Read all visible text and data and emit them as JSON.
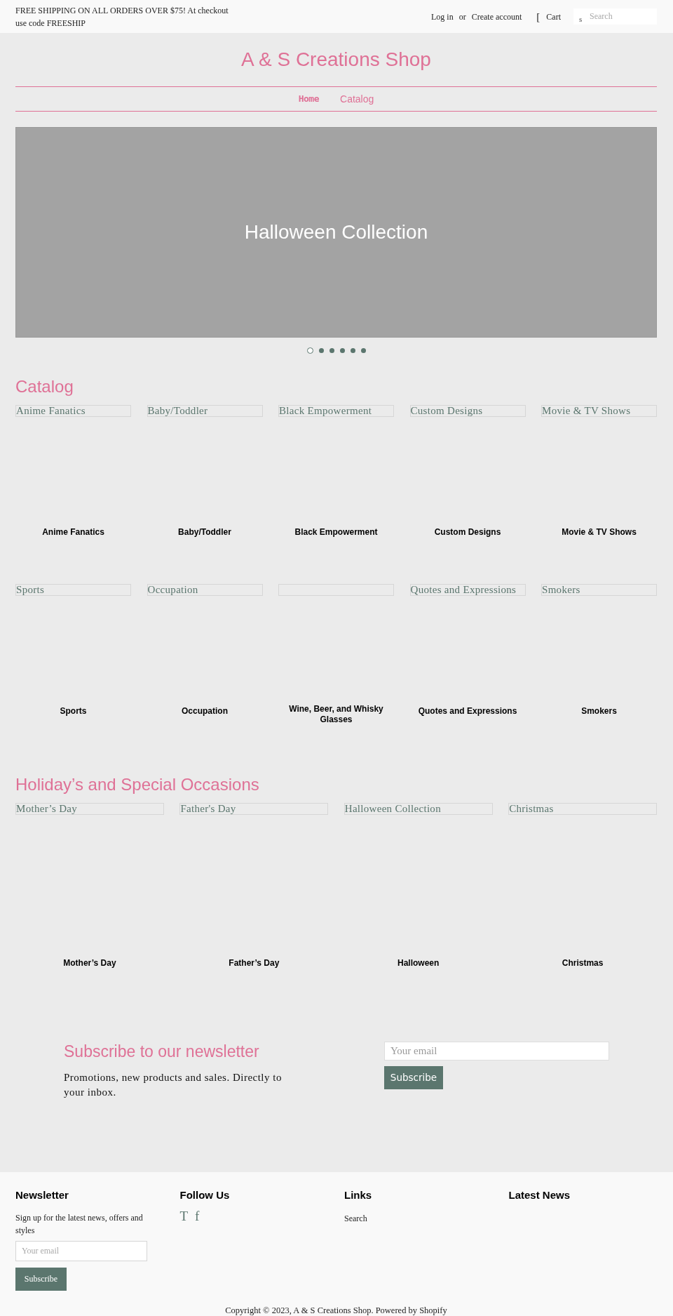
{
  "top_bar": {
    "announcement": "FREE SHIPPING ON ALL ORDERS OVER $75! At checkout use code FREESHIP",
    "login": "Log in",
    "separator": "or",
    "register": "Create account",
    "cart": {
      "glyph": "[",
      "label": "Cart"
    },
    "search": {
      "glyph": "s",
      "placeholder": "Search"
    }
  },
  "header": {
    "title": "A & S Creations Shop"
  },
  "nav": [
    {
      "label": "Home",
      "selected": true
    },
    {
      "label": "Catalog",
      "selected": false
    }
  ],
  "slideshow": {
    "caption": "Halloween Collection",
    "dots": [
      {
        "selected": true
      },
      {
        "selected": false
      },
      {
        "selected": false
      },
      {
        "selected": false
      },
      {
        "selected": false
      },
      {
        "selected": false
      }
    ]
  },
  "sections": [
    {
      "heading": "Catalog",
      "items": [
        {
          "image_alt": "Anime Fanatics",
          "caption": "Anime Fanatics"
        },
        {
          "image_alt": "Baby/Toddler",
          "caption": "Baby/Toddler"
        },
        {
          "image_alt": "Black Empowerment",
          "caption": "Black Empowerment"
        },
        {
          "image_alt": "Custom Designs",
          "caption": "Custom Designs"
        },
        {
          "image_alt": "Movie & TV Shows",
          "caption": "Movie & TV Shows"
        },
        {
          "image_alt": "Sports",
          "caption": "Sports"
        },
        {
          "image_alt": "Occupation",
          "caption": "Occupation"
        },
        {
          "caption": "Wine, Beer, and Whisky Glasses"
        },
        {
          "image_alt": "Quotes and Expressions",
          "caption": "Quotes and Expressions"
        },
        {
          "image_alt": "Smokers",
          "caption": "Smokers"
        }
      ]
    },
    {
      "heading": "Holiday’s and Special Occasions",
      "items": [
        {
          "image_alt": "Mother’s Day",
          "caption": "Mother’s Day"
        },
        {
          "image_alt": "Father's Day",
          "caption": "Father’s Day"
        },
        {
          "image_alt": "Halloween Collection",
          "caption": "Halloween"
        },
        {
          "image_alt": "Christmas",
          "caption": "Christmas"
        }
      ]
    }
  ],
  "newsletter": {
    "heading": "Subscribe to our newsletter",
    "text": "Promotions, new products and sales. Directly to your inbox.",
    "placeholder": "Your email",
    "button": "Subscribe"
  },
  "footer": {
    "newsletter": {
      "heading": "Newsletter",
      "text": "Sign up for the latest news, offers and styles",
      "placeholder": "Your email",
      "button": "Subscribe"
    },
    "follow": {
      "heading": "Follow Us",
      "glyphs": [
        "T",
        "f"
      ]
    },
    "links": {
      "heading": "Links",
      "items": [
        "Search"
      ]
    },
    "news": {
      "heading": "Latest News"
    },
    "copyright": "Copyright © 2023, A & S Creations Shop. Powered by Shopify"
  }
}
